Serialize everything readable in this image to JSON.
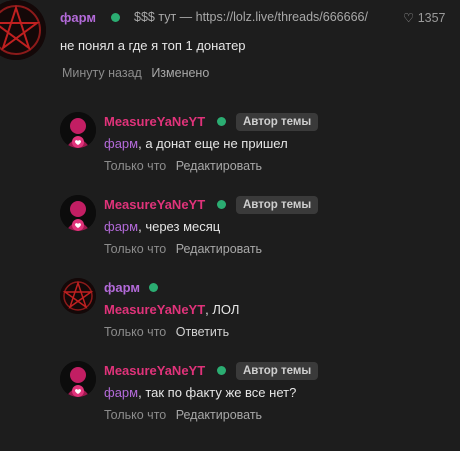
{
  "post": {
    "author": "фарм",
    "status": "$$$ тут — https://lolz.live/threads/666666/",
    "likes": "1357",
    "text": "не понял а где я топ 1 донатер",
    "time": "Минуту назад",
    "edited": "Изменено"
  },
  "replies": [
    {
      "author": "MeasureYaNeYT",
      "badge": "Автор темы",
      "mention": "фарм",
      "text": ", а донат еще не пришел",
      "time": "Только что",
      "action": "Редактировать"
    },
    {
      "author": "MeasureYaNeYT",
      "badge": "Автор темы",
      "mention": "фарм",
      "text": ", через месяц",
      "time": "Только что",
      "action": "Редактировать"
    },
    {
      "author": "фарм",
      "mention": "MeasureYaNeYT",
      "text": ", ЛОЛ",
      "time": "Только что",
      "action": "Ответить"
    },
    {
      "author": "MeasureYaNeYT",
      "badge": "Автор темы",
      "mention": "фарм",
      "text": ", так по факту же все нет?",
      "time": "Только что",
      "action": "Редактировать"
    }
  ],
  "colors": {
    "background": "#1d1d1d",
    "pink_name": "#e0337a",
    "purple_name": "#b36ad9",
    "online": "#2bad72"
  }
}
